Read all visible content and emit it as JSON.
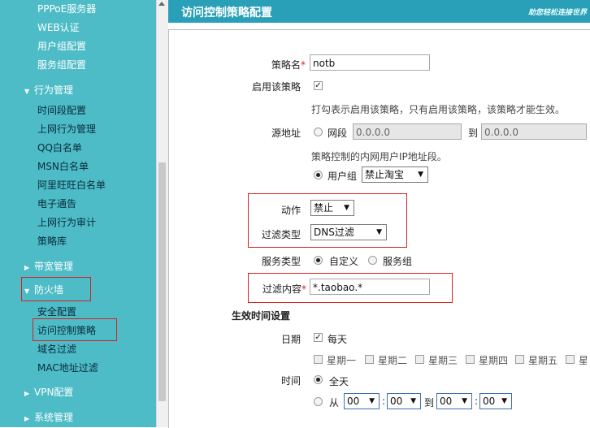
{
  "sidebar": {
    "top_items": [
      "PPPoE服务器",
      "WEB认证",
      "用户组配置",
      "服务组配置"
    ],
    "behavior_group": "行为管理",
    "behavior_items": [
      "时间段配置",
      "上网行为管理",
      "QQ白名单",
      "MSN白名单",
      "阿里旺旺白名单",
      "电子通告",
      "上网行为审计",
      "策略库"
    ],
    "bandwidth_group": "带宽管理",
    "firewall_group": "防火墙",
    "firewall_items": [
      "安全配置",
      "访问控制策略",
      "域名过滤",
      "MAC地址过滤"
    ],
    "vpn_group": "VPN配置",
    "system_group": "系统管理"
  },
  "header": {
    "title": "访问控制策略配置",
    "brand": "助您轻松连接世界"
  },
  "form": {
    "policy_name_label": "策略名",
    "required_mark": "*",
    "policy_name_value": "notb",
    "enable_label": "启用该策略",
    "enable_checked": true,
    "enable_hint": "打勾表示启用该策略，只有启用该策略，该策略才能生效。",
    "source_label": "源地址",
    "ip_range_option": "网段",
    "ip_start": "0.0.0.0",
    "to_label": "到",
    "ip_end": "0.0.0.0",
    "source_hint": "策略控制的内网用户IP地址段。",
    "user_group_option": "用户组",
    "user_group_value": "禁止淘宝",
    "action_label": "动作",
    "action_value": "禁止",
    "filter_type_label": "过滤类型",
    "filter_type_value": "DNS过滤",
    "service_type_label": "服务类型",
    "service_custom": "自定义",
    "service_group": "服务组",
    "filter_content_label": "过滤内容",
    "filter_content_value": "*.taobao.*",
    "effective_time_title": "生效时间设置",
    "date_label": "日期",
    "every_day": "每天",
    "weekdays": [
      "星期一",
      "星期二",
      "星期三",
      "星期四",
      "星期五",
      "星"
    ],
    "time_label": "时间",
    "all_day": "全天",
    "from_label": "从",
    "to2_label": "到",
    "colon": ":",
    "h1": "00",
    "m1": "00",
    "h2": "00",
    "m2": "00"
  }
}
